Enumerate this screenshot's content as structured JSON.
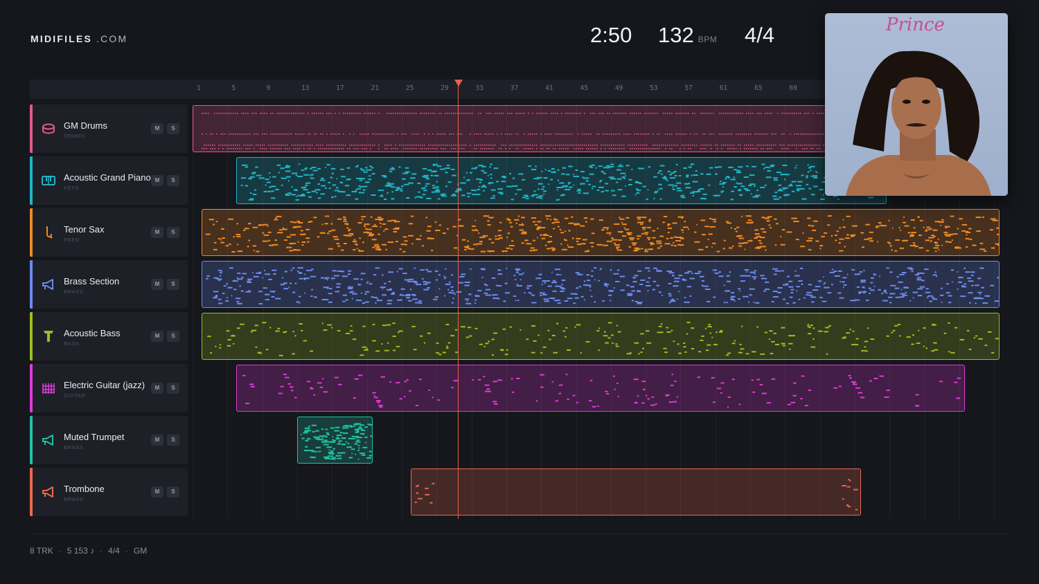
{
  "brand": {
    "bold": "MIDIFILES",
    "light": ".COM"
  },
  "transport": {
    "time": "2:50",
    "tempo": "132",
    "tempo_unit": "BPM",
    "signature": "4/4"
  },
  "ruler": {
    "bars": [
      "1",
      "5",
      "9",
      "13",
      "17",
      "21",
      "25",
      "29",
      "33",
      "37",
      "41",
      "45",
      "49",
      "53",
      "57",
      "61",
      "65",
      "69"
    ]
  },
  "playhead_bar": 30,
  "buttons": {
    "mute": "M",
    "solo": "S"
  },
  "tracks": [
    {
      "name": "GM Drums",
      "category": "DRUMS",
      "color": "#e35a8c",
      "icon": "drum-icon",
      "clips": [
        [
          1,
          81
        ]
      ],
      "pattern": "drums"
    },
    {
      "name": "Acoustic Grand Piano",
      "category": "KEYS",
      "color": "#1fb6c8",
      "icon": "piano-icon",
      "clips": [
        [
          6,
          80
        ]
      ],
      "pattern": "piano"
    },
    {
      "name": "Tenor Sax",
      "category": "REED",
      "color": "#f08a24",
      "icon": "saxophone-icon",
      "clips": [
        [
          2,
          93
        ]
      ],
      "pattern": "sax"
    },
    {
      "name": "Brass Section",
      "category": "BRASS",
      "color": "#6c8cf0",
      "icon": "horn-icon",
      "clips": [
        [
          2,
          93
        ]
      ],
      "pattern": "brass"
    },
    {
      "name": "Acoustic Bass",
      "category": "BASS",
      "color": "#9cbf1e",
      "icon": "bass-icon",
      "clips": [
        [
          2,
          93
        ]
      ],
      "pattern": "bass"
    },
    {
      "name": "Electric Guitar (jazz)",
      "category": "GUITAR",
      "color": "#e03ad8",
      "icon": "guitar-icon",
      "clips": [
        [
          6,
          89
        ]
      ],
      "pattern": "guitar"
    },
    {
      "name": "Muted Trumpet",
      "category": "BRASS",
      "color": "#22c2a4",
      "icon": "trumpet-icon",
      "clips": [
        [
          13,
          21
        ]
      ],
      "pattern": "trumpet"
    },
    {
      "name": "Trombone",
      "category": "BRASS",
      "color": "#ea6a50",
      "icon": "trombone-icon",
      "clips": [
        [
          26,
          77
        ]
      ],
      "pattern": "trombone"
    }
  ],
  "album_art": {
    "script_title": "Prince"
  },
  "footer": {
    "tracks": "8 TRK",
    "notes": "5 153 ♪",
    "signature": "4/4",
    "standard": "GM"
  }
}
